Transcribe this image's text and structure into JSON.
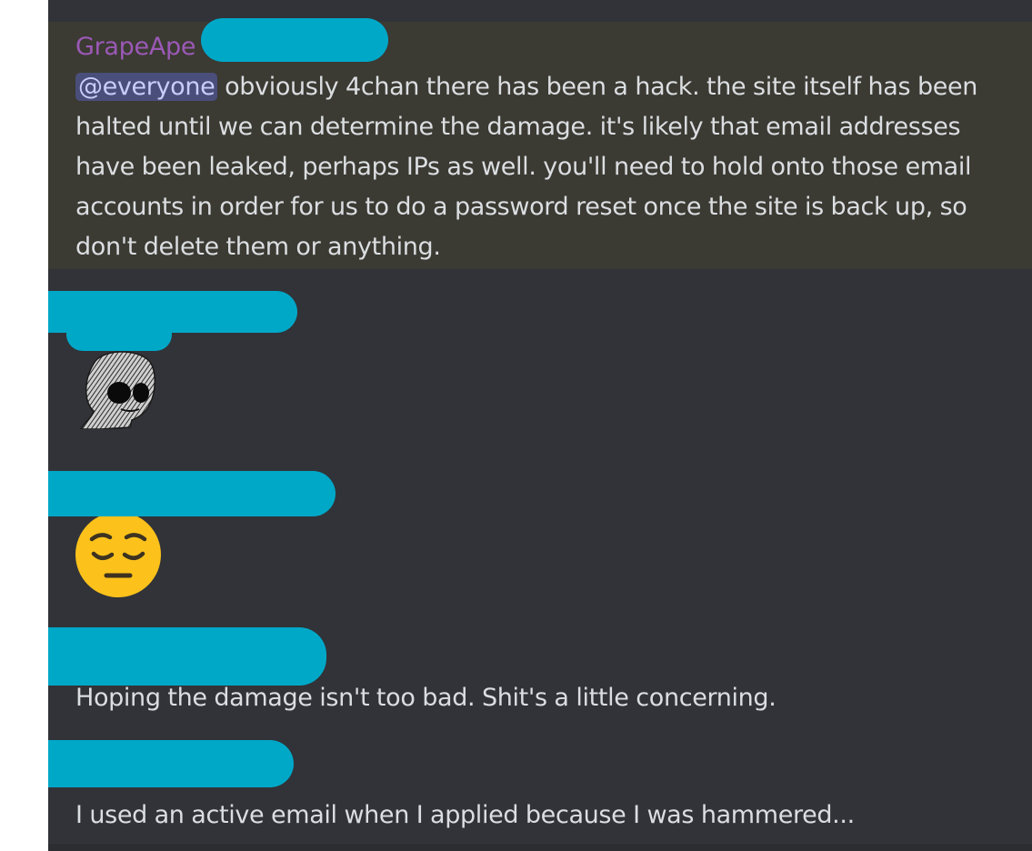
{
  "messages": [
    {
      "author": "GrapeApe",
      "mention": "@everyone",
      "text_line1": " obviously 4chan there has been a hack. the site itself has been",
      "text_line2": "halted until we can determine the damage. it's likely that email addresses",
      "text_line3": "have been leaked, perhaps IPs as well. you'll need to hold onto those email",
      "text_line4": "accounts in order for us to do a password reset once the site is back up, so",
      "text_line5": "don't delete them or anything.",
      "highlighted": true
    },
    {
      "author": "[redacted]",
      "content_type": "sticker",
      "sticker": "wojak-doomer-face"
    },
    {
      "author": "[redacted]",
      "content_type": "emoji",
      "emoji": "pensive-face"
    },
    {
      "author": "[redacted]",
      "text": "Hoping the damage isn't too bad. Shit's a little concerning."
    },
    {
      "author": "[redacted]",
      "text": "I used an active email when I applied because I was hammered..."
    }
  ],
  "colors": {
    "background": "#313338",
    "highlight": "#3b3a33",
    "username": "#9b59b6",
    "mention_bg": "#4a4e7a",
    "mention_text": "#c9cdfb",
    "text": "#dbdee1",
    "redaction": "#00a8c8"
  }
}
